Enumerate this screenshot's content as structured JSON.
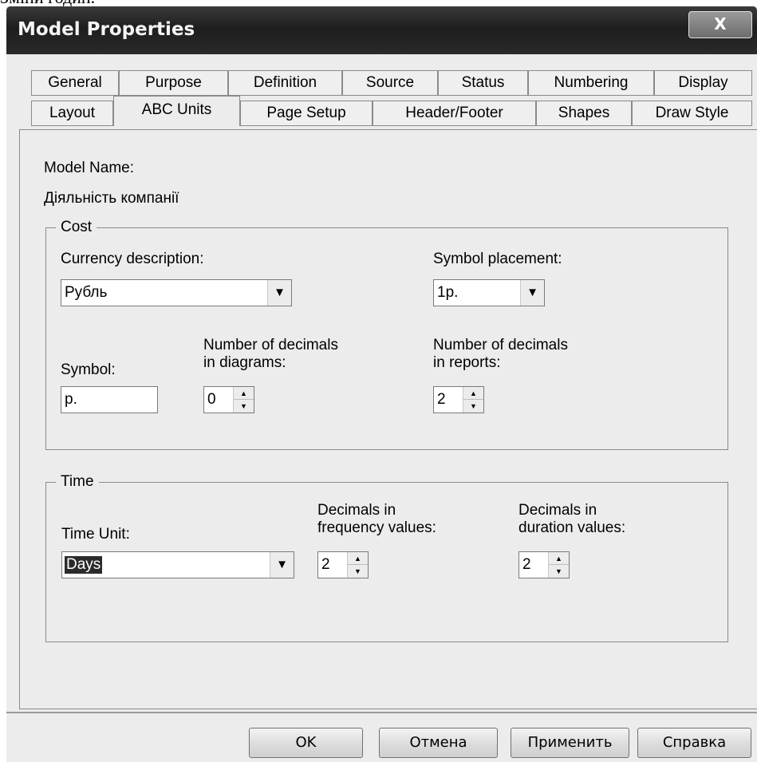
{
  "backdrop_text": "Зміни годин.",
  "window": {
    "title": "Model Properties",
    "close_label": "X"
  },
  "tabs_row1": [
    "General",
    "Purpose",
    "Definition",
    "Source",
    "Status",
    "Numbering",
    "Display"
  ],
  "tabs_row2": [
    "Layout",
    "ABC Units",
    "Page Setup",
    "Header/Footer",
    "Shapes",
    "Draw Style"
  ],
  "active_tab": "ABC Units",
  "model": {
    "name_label": "Model Name:",
    "name_value": "Діяльність компанії"
  },
  "cost": {
    "group_label": "Cost",
    "currency_label": "Currency description:",
    "currency_value": "Рубль",
    "placement_label": "Symbol placement:",
    "placement_value": "1р.",
    "symbol_label": "Symbol:",
    "symbol_value": "р.",
    "diag_decimals_label_1": "Number of decimals",
    "diag_decimals_label_2": "in diagrams:",
    "diag_decimals_value": "0",
    "rep_decimals_label_1": "Number of decimals",
    "rep_decimals_label_2": "in reports:",
    "rep_decimals_value": "2"
  },
  "time": {
    "group_label": "Time",
    "unit_label": "Time Unit:",
    "unit_value": "Days",
    "freq_label_1": "Decimals in",
    "freq_label_2": "frequency values:",
    "freq_value": "2",
    "dur_label_1": "Decimals in",
    "dur_label_2": "duration values:",
    "dur_value": "2"
  },
  "buttons": {
    "ok": "OK",
    "cancel": "Отмена",
    "apply": "Применить",
    "help": "Справка"
  }
}
